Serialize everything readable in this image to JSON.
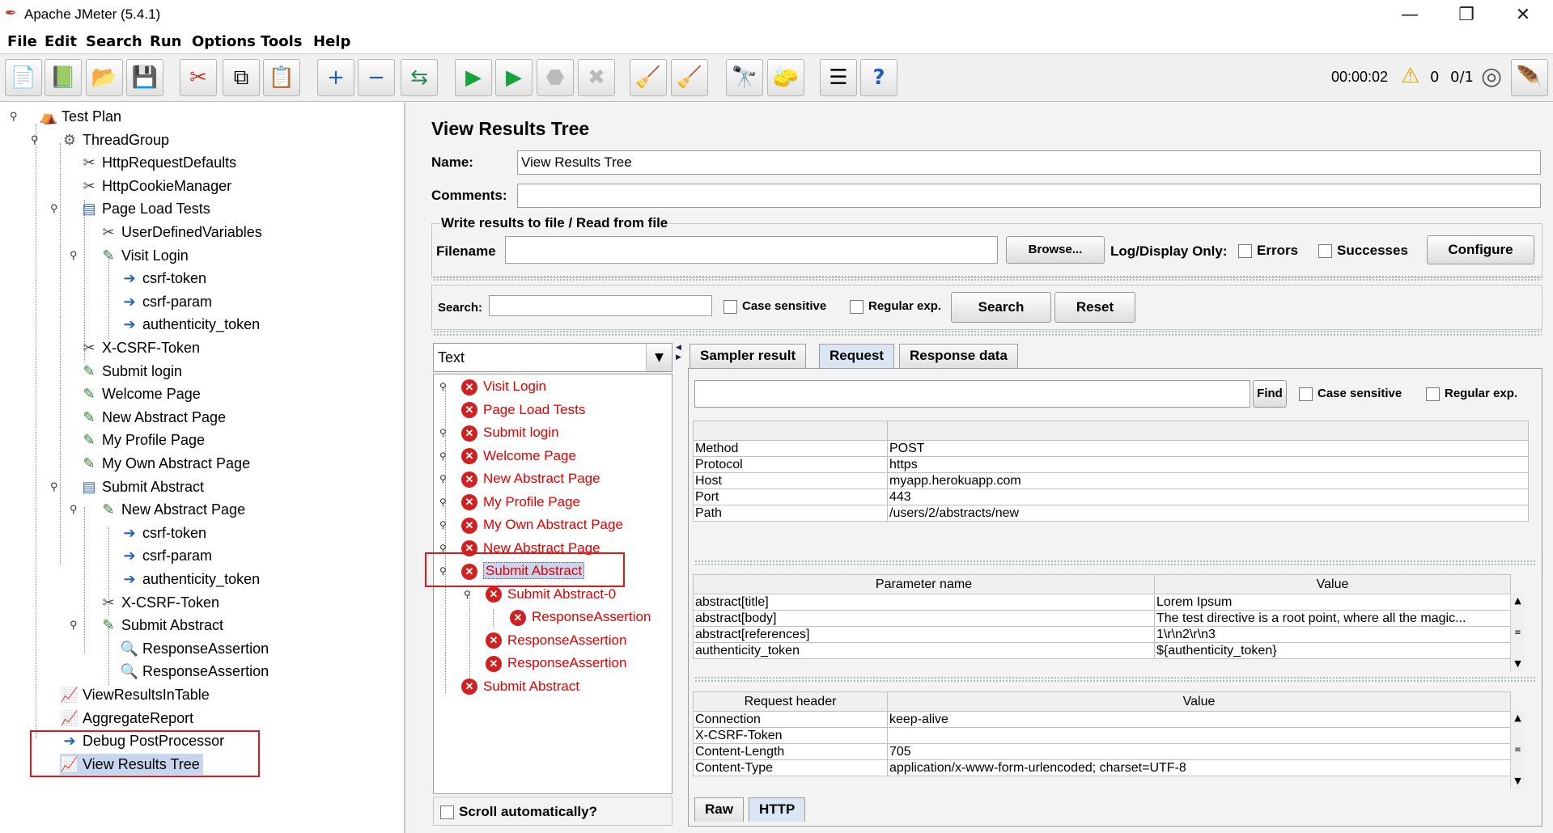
{
  "window": {
    "title": "Apache JMeter (5.4.1)",
    "minimize_glyph": "—",
    "restore_glyph": "❐",
    "close_glyph": "✕"
  },
  "menu": [
    "File",
    "Edit",
    "Search",
    "Run",
    "Options",
    "Tools",
    "Help"
  ],
  "toolbar": {
    "icons": [
      "new-icon",
      "templates-icon",
      "open-icon",
      "save-icon",
      "cut-icon",
      "copy-icon",
      "paste-icon",
      "expand-icon",
      "collapse-icon",
      "toggle-icon",
      "start-icon",
      "start-no-pauses-icon",
      "stop-icon",
      "shutdown-icon",
      "clear-icon",
      "clear-all-icon",
      "search-icon",
      "reset-search-icon",
      "function-helper-icon",
      "help-icon"
    ],
    "timer": "00:00:02",
    "warning_count": "0",
    "threads": "0/1"
  },
  "tree": [
    {
      "label": "Test Plan",
      "icon": "test-plan-icon"
    },
    {
      "label": "ThreadGroup",
      "icon": "gear-icon"
    },
    {
      "label": "HttpRequestDefaults",
      "icon": "tools-icon"
    },
    {
      "label": "HttpCookieManager",
      "icon": "tools-icon"
    },
    {
      "label": "Page Load Tests",
      "icon": "controller-icon"
    },
    {
      "label": "UserDefinedVariables",
      "icon": "tools-icon"
    },
    {
      "label": "Visit Login",
      "icon": "pipette-icon"
    },
    {
      "label": "csrf-token",
      "icon": "arrow-icon"
    },
    {
      "label": "csrf-param",
      "icon": "arrow-icon"
    },
    {
      "label": "authenticity_token",
      "icon": "arrow-icon"
    },
    {
      "label": "X-CSRF-Token",
      "icon": "tools-icon"
    },
    {
      "label": "Submit login",
      "icon": "pipette-icon"
    },
    {
      "label": "Welcome Page",
      "icon": "pipette-icon"
    },
    {
      "label": "New Abstract Page",
      "icon": "pipette-icon"
    },
    {
      "label": "My Profile Page",
      "icon": "pipette-icon"
    },
    {
      "label": "My Own Abstract Page",
      "icon": "pipette-icon"
    },
    {
      "label": "Submit Abstract",
      "icon": "controller-icon"
    },
    {
      "label": "New Abstract Page",
      "icon": "pipette-icon"
    },
    {
      "label": "csrf-token",
      "icon": "arrow-icon"
    },
    {
      "label": "csrf-param",
      "icon": "arrow-icon"
    },
    {
      "label": "authenticity_token",
      "icon": "arrow-icon"
    },
    {
      "label": "X-CSRF-Token",
      "icon": "tools-icon"
    },
    {
      "label": "Submit Abstract",
      "icon": "pipette-icon"
    },
    {
      "label": "ResponseAssertion",
      "icon": "magnifier-icon"
    },
    {
      "label": "ResponseAssertion",
      "icon": "magnifier-icon"
    },
    {
      "label": "ViewResultsInTable",
      "icon": "graph-icon"
    },
    {
      "label": "AggregateReport",
      "icon": "graph-icon"
    },
    {
      "label": "Debug PostProcessor",
      "icon": "arrow-icon"
    },
    {
      "label": "View Results Tree",
      "icon": "graph-icon"
    }
  ],
  "panel": {
    "title": "View Results Tree",
    "name_label": "Name:",
    "name_value": "View Results Tree",
    "comments_label": "Comments:",
    "comments_value": "",
    "file_group_title": "Write results to file / Read from file",
    "filename_label": "Filename",
    "filename_value": "",
    "browse_label": "Browse...",
    "log_display_label": "Log/Display Only:",
    "errors_label": "Errors",
    "successes_label": "Successes",
    "configure_label": "Configure",
    "search_label": "Search:",
    "search_value": "",
    "case_sensitive_label": "Case sensitive",
    "regular_exp_label": "Regular exp.",
    "search_button": "Search",
    "reset_button": "Reset"
  },
  "renderer": {
    "selected": "Text",
    "scroll_auto_label": "Scroll automatically?"
  },
  "results": [
    {
      "label": "Visit Login"
    },
    {
      "label": "Page Load Tests"
    },
    {
      "label": "Submit login"
    },
    {
      "label": "Welcome Page"
    },
    {
      "label": "New Abstract Page"
    },
    {
      "label": "My Profile Page"
    },
    {
      "label": "My Own Abstract Page"
    },
    {
      "label": "New Abstract Page"
    },
    {
      "label": "Submit Abstract"
    },
    {
      "label": "Submit Abstract-0"
    },
    {
      "label": "ResponseAssertion"
    },
    {
      "label": "ResponseAssertion"
    },
    {
      "label": "ResponseAssertion"
    },
    {
      "label": "Submit Abstract"
    }
  ],
  "detail_tabs": [
    "Sampler result",
    "Request",
    "Response data"
  ],
  "find": {
    "value": "",
    "find_button": "Find",
    "case_sensitive_label": "Case sensitive",
    "regular_exp_label": "Regular exp."
  },
  "request_table": [
    {
      "key": "Method",
      "value": "POST"
    },
    {
      "key": "Protocol",
      "value": "https"
    },
    {
      "key": "Host",
      "value": "myapp.herokuapp.com"
    },
    {
      "key": "Port",
      "value": "443"
    },
    {
      "key": "Path",
      "value": "/users/2/abstracts/new"
    }
  ],
  "params_table": {
    "headers": [
      "Parameter name",
      "Value"
    ],
    "rows": [
      {
        "key": "abstract[title]",
        "value": "Lorem Ipsum"
      },
      {
        "key": "abstract[body]",
        "value": "The test directive is a root point, where all the magic..."
      },
      {
        "key": "abstract[references]",
        "value": "1\\r\\n2\\r\\n3"
      },
      {
        "key": "authenticity_token",
        "value": "${authenticity_token}"
      }
    ]
  },
  "headers_table": {
    "headers": [
      "Request header",
      "Value"
    ],
    "rows": [
      {
        "key": "Connection",
        "value": "keep-alive"
      },
      {
        "key": "X-CSRF-Token",
        "value": ""
      },
      {
        "key": "Content-Length",
        "value": "705"
      },
      {
        "key": "Content-Type",
        "value": "application/x-www-form-urlencoded; charset=UTF-8"
      }
    ]
  },
  "bottom_tabs": [
    "Raw",
    "HTTP"
  ],
  "colors": {
    "error_text": "#e00000",
    "highlight_box": "#e01818",
    "selection": "#c7d6ee"
  }
}
